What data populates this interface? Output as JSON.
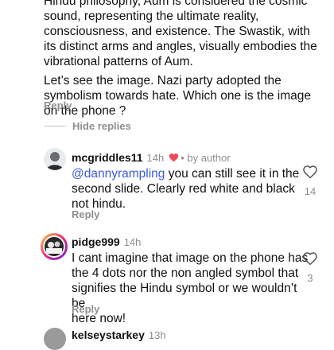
{
  "top_comment": {
    "lines": [
      "Hindu philosophy, Aum is considered the cosmic",
      "sound, representing the ultimate reality,",
      "consciousness, and existence. The Swastik, with",
      "its distinct arms and angles, visually embodies the",
      "vibrational patterns of Aum."
    ],
    "lines2": [
      "Let’s see the image. Nazi party adopted the",
      "symbolism towards hate. Which one is the image",
      "on the phone ?"
    ],
    "reply_label": "Reply"
  },
  "hide_replies_label": "Hide replies",
  "replies": [
    {
      "username": "mcgriddles11",
      "time": "14h",
      "by_author": "by author",
      "mention": "@dannyrampling",
      "lines": [
        " you can still see it in the",
        "second slide. Clearly red white and black",
        "not hindu."
      ],
      "reply_label": "Reply",
      "likes": "14"
    },
    {
      "username": "pidge999",
      "time": "14h",
      "lines": [
        "I cant imagine that image on the phone has",
        "the 4 dots nor the non angled symbol that",
        "signifies the Hindu symbol or we wouldn’t be",
        "here now!"
      ],
      "reply_label": "Reply",
      "likes": "3"
    },
    {
      "username": "kelseystarkey",
      "time": "13h"
    }
  ],
  "colors": {
    "heart_red": "#ed4956",
    "mention_blue": "#3b5bdb",
    "muted_gray": "#8e8e8e"
  }
}
